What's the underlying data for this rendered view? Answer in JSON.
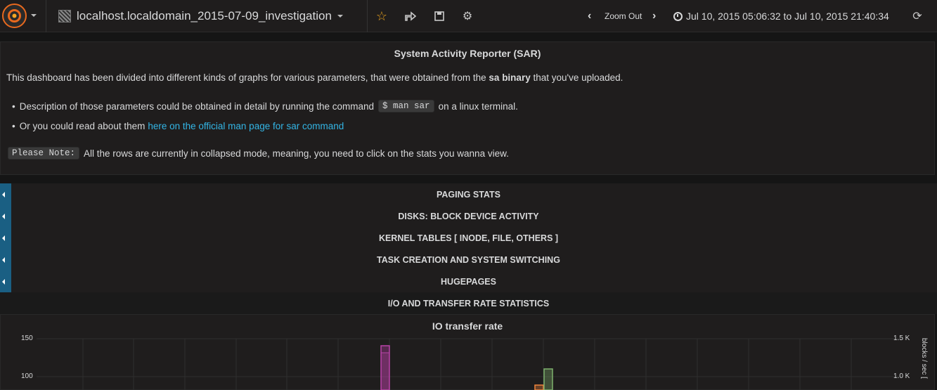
{
  "nav": {
    "dashboard_title": "localhost.localdomain_2015-07-09_investigation",
    "zoom_label": "Zoom Out",
    "time_range": "Jul 10, 2015 05:06:32 to Jul 10, 2015 21:40:34",
    "icons": [
      "grafana-logo-icon",
      "star-icon",
      "share-icon",
      "save-icon",
      "settings-icon",
      "chevron-left-icon",
      "chevron-right-icon",
      "clock-icon",
      "refresh-icon"
    ],
    "accent": "#e8a21e"
  },
  "text_panel": {
    "title": "System Activity Reporter (SAR)",
    "intro_before": "This dashboard has been divided into different kinds of graphs for various parameters, that were obtained from the",
    "intro_bold": "sa binary",
    "intro_after": "that you've uploaded.",
    "bullet1_before": "Description of those parameters could be obtained in detail by running the command",
    "bullet1_code": "$ man sar",
    "bullet1_after": "on a linux terminal.",
    "bullet2_before": "Or you could read about them",
    "bullet2_link": "here on the official man page for sar command",
    "note_code": "Please Note:",
    "note_text": "All the rows are currently in collapsed mode, meaning, you need to click on the stats you wanna view."
  },
  "rows": [
    {
      "title": "PAGING STATS"
    },
    {
      "title": "DISKS: BLOCK DEVICE ACTIVITY"
    },
    {
      "title": "KERNEL TABLES [ INODE, FILE, OTHERS ]"
    },
    {
      "title": "TASK CREATION AND SYSTEM SWITCHING"
    },
    {
      "title": "HUGEPAGES"
    },
    {
      "title": "I/O AND TRANSFER RATE STATISTICS"
    }
  ],
  "graph": {
    "title": "IO transfer rate",
    "y_left_ticks": [
      "150",
      "100"
    ],
    "y_right_ticks": [
      "1.5 K",
      "1.0 K"
    ],
    "y_right_label": "blocks / sec [",
    "series_colors": [
      "#ba43a9",
      "#ef843c",
      "#7eb26d"
    ]
  }
}
